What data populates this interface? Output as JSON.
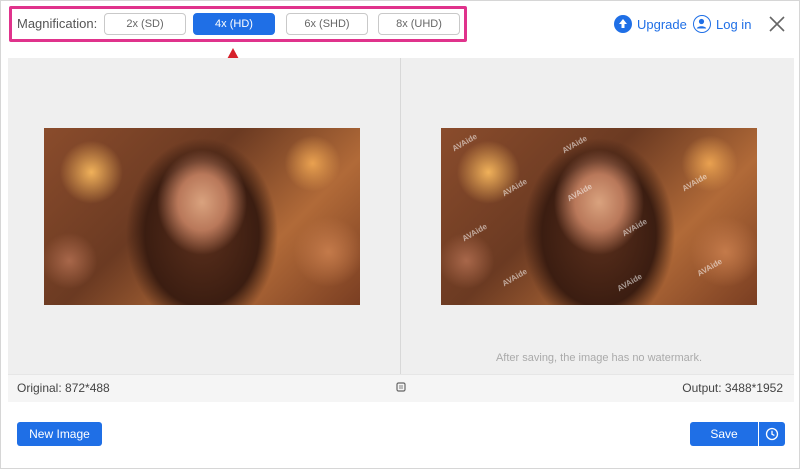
{
  "toolbar": {
    "magnification_label": "Magnification:",
    "options": [
      "2x (SD)",
      "4x (HD)",
      "6x (SHD)",
      "8x (UHD)"
    ],
    "selected": "4x (HD)",
    "upgrade_label": "Upgrade",
    "login_label": "Log in"
  },
  "preview": {
    "watermark_text": "AVAide",
    "no_watermark_note": "After saving, the image has no watermark."
  },
  "info": {
    "original": "Original: 872*488",
    "output": "Output: 3488*1952"
  },
  "footer": {
    "new_image_label": "New Image",
    "save_label": "Save"
  },
  "colors": {
    "accent": "#1f6fe6",
    "highlight": "#e0338c",
    "annotation_arrow": "#d6202a"
  },
  "icons": [
    "upload-arrow-icon",
    "user-icon",
    "close-icon",
    "compare-icon",
    "clock-icon"
  ]
}
